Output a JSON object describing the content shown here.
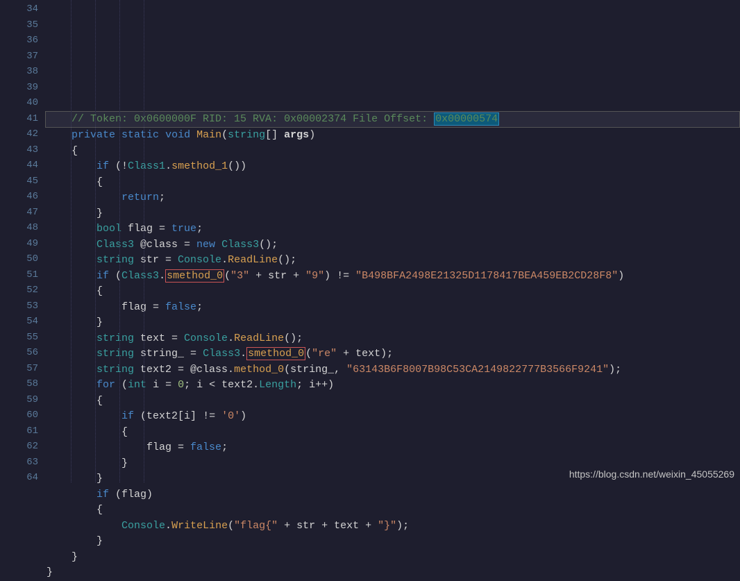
{
  "lineStart": 34,
  "lines": [
    {
      "n": 34,
      "pre": "",
      "tokens": []
    },
    {
      "n": 35,
      "pre": "    ",
      "cls": "line-35",
      "tokens": [
        {
          "t": "// Token: 0x0600000F RID: 15 RVA: 0x00002374 File Offset: ",
          "c": "c-comment"
        },
        {
          "t": "0x00000574",
          "c": "c-comment highlight-offset"
        }
      ]
    },
    {
      "n": 36,
      "pre": "    ",
      "tokens": [
        {
          "t": "private",
          "c": "c-key"
        },
        {
          "t": " "
        },
        {
          "t": "static",
          "c": "c-key"
        },
        {
          "t": " "
        },
        {
          "t": "void",
          "c": "c-key"
        },
        {
          "t": " "
        },
        {
          "t": "Main",
          "c": "c-method"
        },
        {
          "t": "("
        },
        {
          "t": "string",
          "c": "c-type"
        },
        {
          "t": "[] "
        },
        {
          "t": "args",
          "c": "c-var",
          "b": true
        },
        {
          "t": ")"
        }
      ]
    },
    {
      "n": 37,
      "pre": "    ",
      "tokens": [
        {
          "t": "{"
        }
      ]
    },
    {
      "n": 38,
      "pre": "        ",
      "tokens": [
        {
          "t": "if",
          "c": "c-key"
        },
        {
          "t": " (!"
        },
        {
          "t": "Class1",
          "c": "c-cls"
        },
        {
          "t": "."
        },
        {
          "t": "smethod_1",
          "c": "c-method"
        },
        {
          "t": "())"
        }
      ]
    },
    {
      "n": 39,
      "pre": "        ",
      "tokens": [
        {
          "t": "{"
        }
      ]
    },
    {
      "n": 40,
      "pre": "            ",
      "tokens": [
        {
          "t": "return",
          "c": "c-key"
        },
        {
          "t": ";"
        }
      ]
    },
    {
      "n": 41,
      "pre": "        ",
      "tokens": [
        {
          "t": "}"
        }
      ]
    },
    {
      "n": 42,
      "pre": "        ",
      "tokens": [
        {
          "t": "bool",
          "c": "c-type"
        },
        {
          "t": " flag = "
        },
        {
          "t": "true",
          "c": "c-bool"
        },
        {
          "t": ";"
        }
      ]
    },
    {
      "n": 43,
      "pre": "        ",
      "tokens": [
        {
          "t": "Class3",
          "c": "c-cls"
        },
        {
          "t": " @class = "
        },
        {
          "t": "new",
          "c": "c-key"
        },
        {
          "t": " "
        },
        {
          "t": "Class3",
          "c": "c-cls"
        },
        {
          "t": "();"
        }
      ]
    },
    {
      "n": 44,
      "pre": "        ",
      "tokens": [
        {
          "t": "string",
          "c": "c-type"
        },
        {
          "t": " str = "
        },
        {
          "t": "Console",
          "c": "c-cls"
        },
        {
          "t": "."
        },
        {
          "t": "ReadLine",
          "c": "c-method"
        },
        {
          "t": "();"
        }
      ]
    },
    {
      "n": 45,
      "pre": "        ",
      "tokens": [
        {
          "t": "if",
          "c": "c-key"
        },
        {
          "t": " ("
        },
        {
          "t": "Class3",
          "c": "c-cls"
        },
        {
          "t": "."
        },
        {
          "t": "smethod_0",
          "c": "c-method red-box"
        },
        {
          "t": "("
        },
        {
          "t": "\"3\"",
          "c": "c-str"
        },
        {
          "t": " + str + "
        },
        {
          "t": "\"9\"",
          "c": "c-str"
        },
        {
          "t": ") != "
        },
        {
          "t": "\"B498BFA2498E21325D1178417BEA459EB2CD28F8\"",
          "c": "c-str"
        },
        {
          "t": ")"
        }
      ]
    },
    {
      "n": 46,
      "pre": "        ",
      "tokens": [
        {
          "t": "{"
        }
      ]
    },
    {
      "n": 47,
      "pre": "            ",
      "tokens": [
        {
          "t": "flag = "
        },
        {
          "t": "false",
          "c": "c-bool"
        },
        {
          "t": ";"
        }
      ]
    },
    {
      "n": 48,
      "pre": "        ",
      "tokens": [
        {
          "t": "}"
        }
      ]
    },
    {
      "n": 49,
      "pre": "        ",
      "tokens": [
        {
          "t": "string",
          "c": "c-type"
        },
        {
          "t": " text = "
        },
        {
          "t": "Console",
          "c": "c-cls"
        },
        {
          "t": "."
        },
        {
          "t": "ReadLine",
          "c": "c-method"
        },
        {
          "t": "();"
        }
      ]
    },
    {
      "n": 50,
      "pre": "        ",
      "tokens": [
        {
          "t": "string",
          "c": "c-type"
        },
        {
          "t": " string_ = "
        },
        {
          "t": "Class3",
          "c": "c-cls"
        },
        {
          "t": "."
        },
        {
          "t": "smethod_0",
          "c": "c-method red-box"
        },
        {
          "t": "("
        },
        {
          "t": "\"re\"",
          "c": "c-str"
        },
        {
          "t": " + text);"
        }
      ]
    },
    {
      "n": 51,
      "pre": "        ",
      "tokens": [
        {
          "t": "string",
          "c": "c-type"
        },
        {
          "t": " text2 = @class."
        },
        {
          "t": "method_0",
          "c": "c-method"
        },
        {
          "t": "(string_, "
        },
        {
          "t": "\"63143B6F8007B98C53CA2149822777B3566F9241\"",
          "c": "c-str"
        },
        {
          "t": ");"
        }
      ]
    },
    {
      "n": 52,
      "pre": "        ",
      "tokens": [
        {
          "t": "for",
          "c": "c-key"
        },
        {
          "t": " ("
        },
        {
          "t": "int",
          "c": "c-type"
        },
        {
          "t": " i = "
        },
        {
          "t": "0",
          "c": "c-num"
        },
        {
          "t": "; i < text2."
        },
        {
          "t": "Length",
          "c": "c-cls"
        },
        {
          "t": "; i++)"
        }
      ]
    },
    {
      "n": 53,
      "pre": "        ",
      "tokens": [
        {
          "t": "{"
        }
      ]
    },
    {
      "n": 54,
      "pre": "            ",
      "tokens": [
        {
          "t": "if",
          "c": "c-key"
        },
        {
          "t": " (text2[i] != "
        },
        {
          "t": "'0'",
          "c": "c-str"
        },
        {
          "t": ")"
        }
      ]
    },
    {
      "n": 55,
      "pre": "            ",
      "tokens": [
        {
          "t": "{"
        }
      ]
    },
    {
      "n": 56,
      "pre": "                ",
      "tokens": [
        {
          "t": "flag = "
        },
        {
          "t": "false",
          "c": "c-bool"
        },
        {
          "t": ";"
        }
      ]
    },
    {
      "n": 57,
      "pre": "            ",
      "tokens": [
        {
          "t": "}"
        }
      ]
    },
    {
      "n": 58,
      "pre": "        ",
      "tokens": [
        {
          "t": "}"
        }
      ]
    },
    {
      "n": 59,
      "pre": "        ",
      "tokens": [
        {
          "t": "if",
          "c": "c-key"
        },
        {
          "t": " (flag)"
        }
      ]
    },
    {
      "n": 60,
      "pre": "        ",
      "tokens": [
        {
          "t": "{"
        }
      ]
    },
    {
      "n": 61,
      "pre": "            ",
      "tokens": [
        {
          "t": "Console",
          "c": "c-cls"
        },
        {
          "t": "."
        },
        {
          "t": "WriteLine",
          "c": "c-method"
        },
        {
          "t": "("
        },
        {
          "t": "\"flag{\"",
          "c": "c-str"
        },
        {
          "t": " + str + text + "
        },
        {
          "t": "\"}\"",
          "c": "c-str"
        },
        {
          "t": ");"
        }
      ]
    },
    {
      "n": 62,
      "pre": "        ",
      "tokens": [
        {
          "t": "}"
        }
      ]
    },
    {
      "n": 63,
      "pre": "    ",
      "tokens": [
        {
          "t": "}"
        }
      ]
    },
    {
      "n": 64,
      "pre": "",
      "tokens": [
        {
          "t": "}"
        }
      ]
    }
  ],
  "watermark": "https://blog.csdn.net/weixin_45055269"
}
